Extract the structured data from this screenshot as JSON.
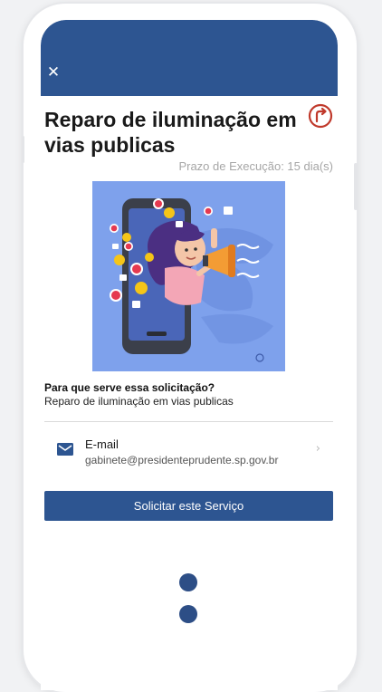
{
  "header": {
    "close_icon": "close-icon",
    "color": "#2d5591"
  },
  "service": {
    "title": "Reparo de iluminação em vias publicas",
    "deadline": "Prazo de Execução: 15 dia(s)",
    "question_label": "Para que serve essa solicitação?",
    "description": "Reparo de iluminação em vias publicas"
  },
  "contact": {
    "icon": "mail-icon",
    "type": "E-mail",
    "value": "gabinete@presidenteprudente.sp.gov.br"
  },
  "cta": {
    "label": "Solicitar este Serviço"
  },
  "colors": {
    "primary": "#2d5591",
    "share": "#c0392b",
    "illustration_bg": "#7ea1ec"
  }
}
